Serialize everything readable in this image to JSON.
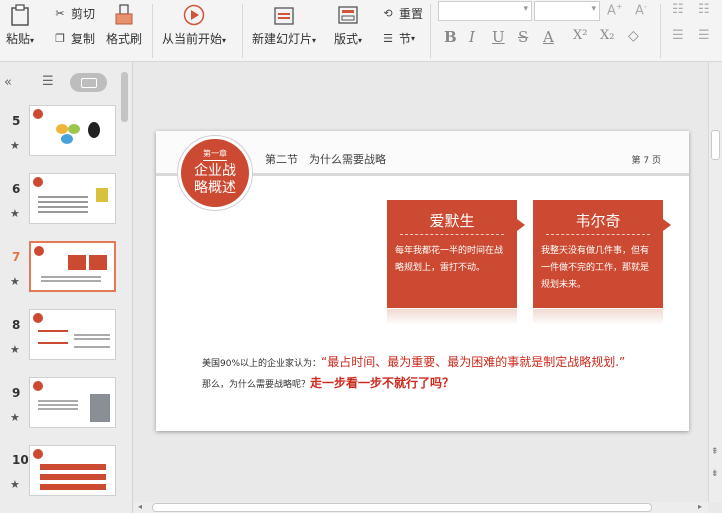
{
  "ribbon": {
    "paste": "粘贴",
    "cut": "剪切",
    "copy": "复制",
    "format_painter": "格式刷",
    "from_current": "从当前开始",
    "new_slide": "新建幻灯片",
    "layout": "版式",
    "reset": "重置",
    "section": "节"
  },
  "slides": [
    {
      "num": "5"
    },
    {
      "num": "6"
    },
    {
      "num": "7"
    },
    {
      "num": "8"
    },
    {
      "num": "9"
    },
    {
      "num": "10"
    }
  ],
  "slide": {
    "chapter_small": "第一章",
    "chapter_title": "企业战略概述",
    "section": "第二节　为什么需要战略",
    "page": "第 7 页",
    "card1": {
      "name": "爱默生",
      "text": "每年我都花一半的时间在战略规划上，雷打不动。"
    },
    "card2": {
      "name": "韦尔奇",
      "text": "我整天没有做几件事，但有一件做不完的工作，那就是规划未来。"
    },
    "quote1_prefix": "美国90%以上的企业家认为：",
    "quote1_red": "“最占时间、最为重要、最为困难的事就是制定战略规划.”",
    "quote2_prefix": "那么，为什么需要战略呢？",
    "quote2_red": "走一步看一步不就行了吗？"
  },
  "colors": {
    "accent": "#cc4a31",
    "selected": "#e47a55",
    "quote_red": "#cc2a1c"
  }
}
